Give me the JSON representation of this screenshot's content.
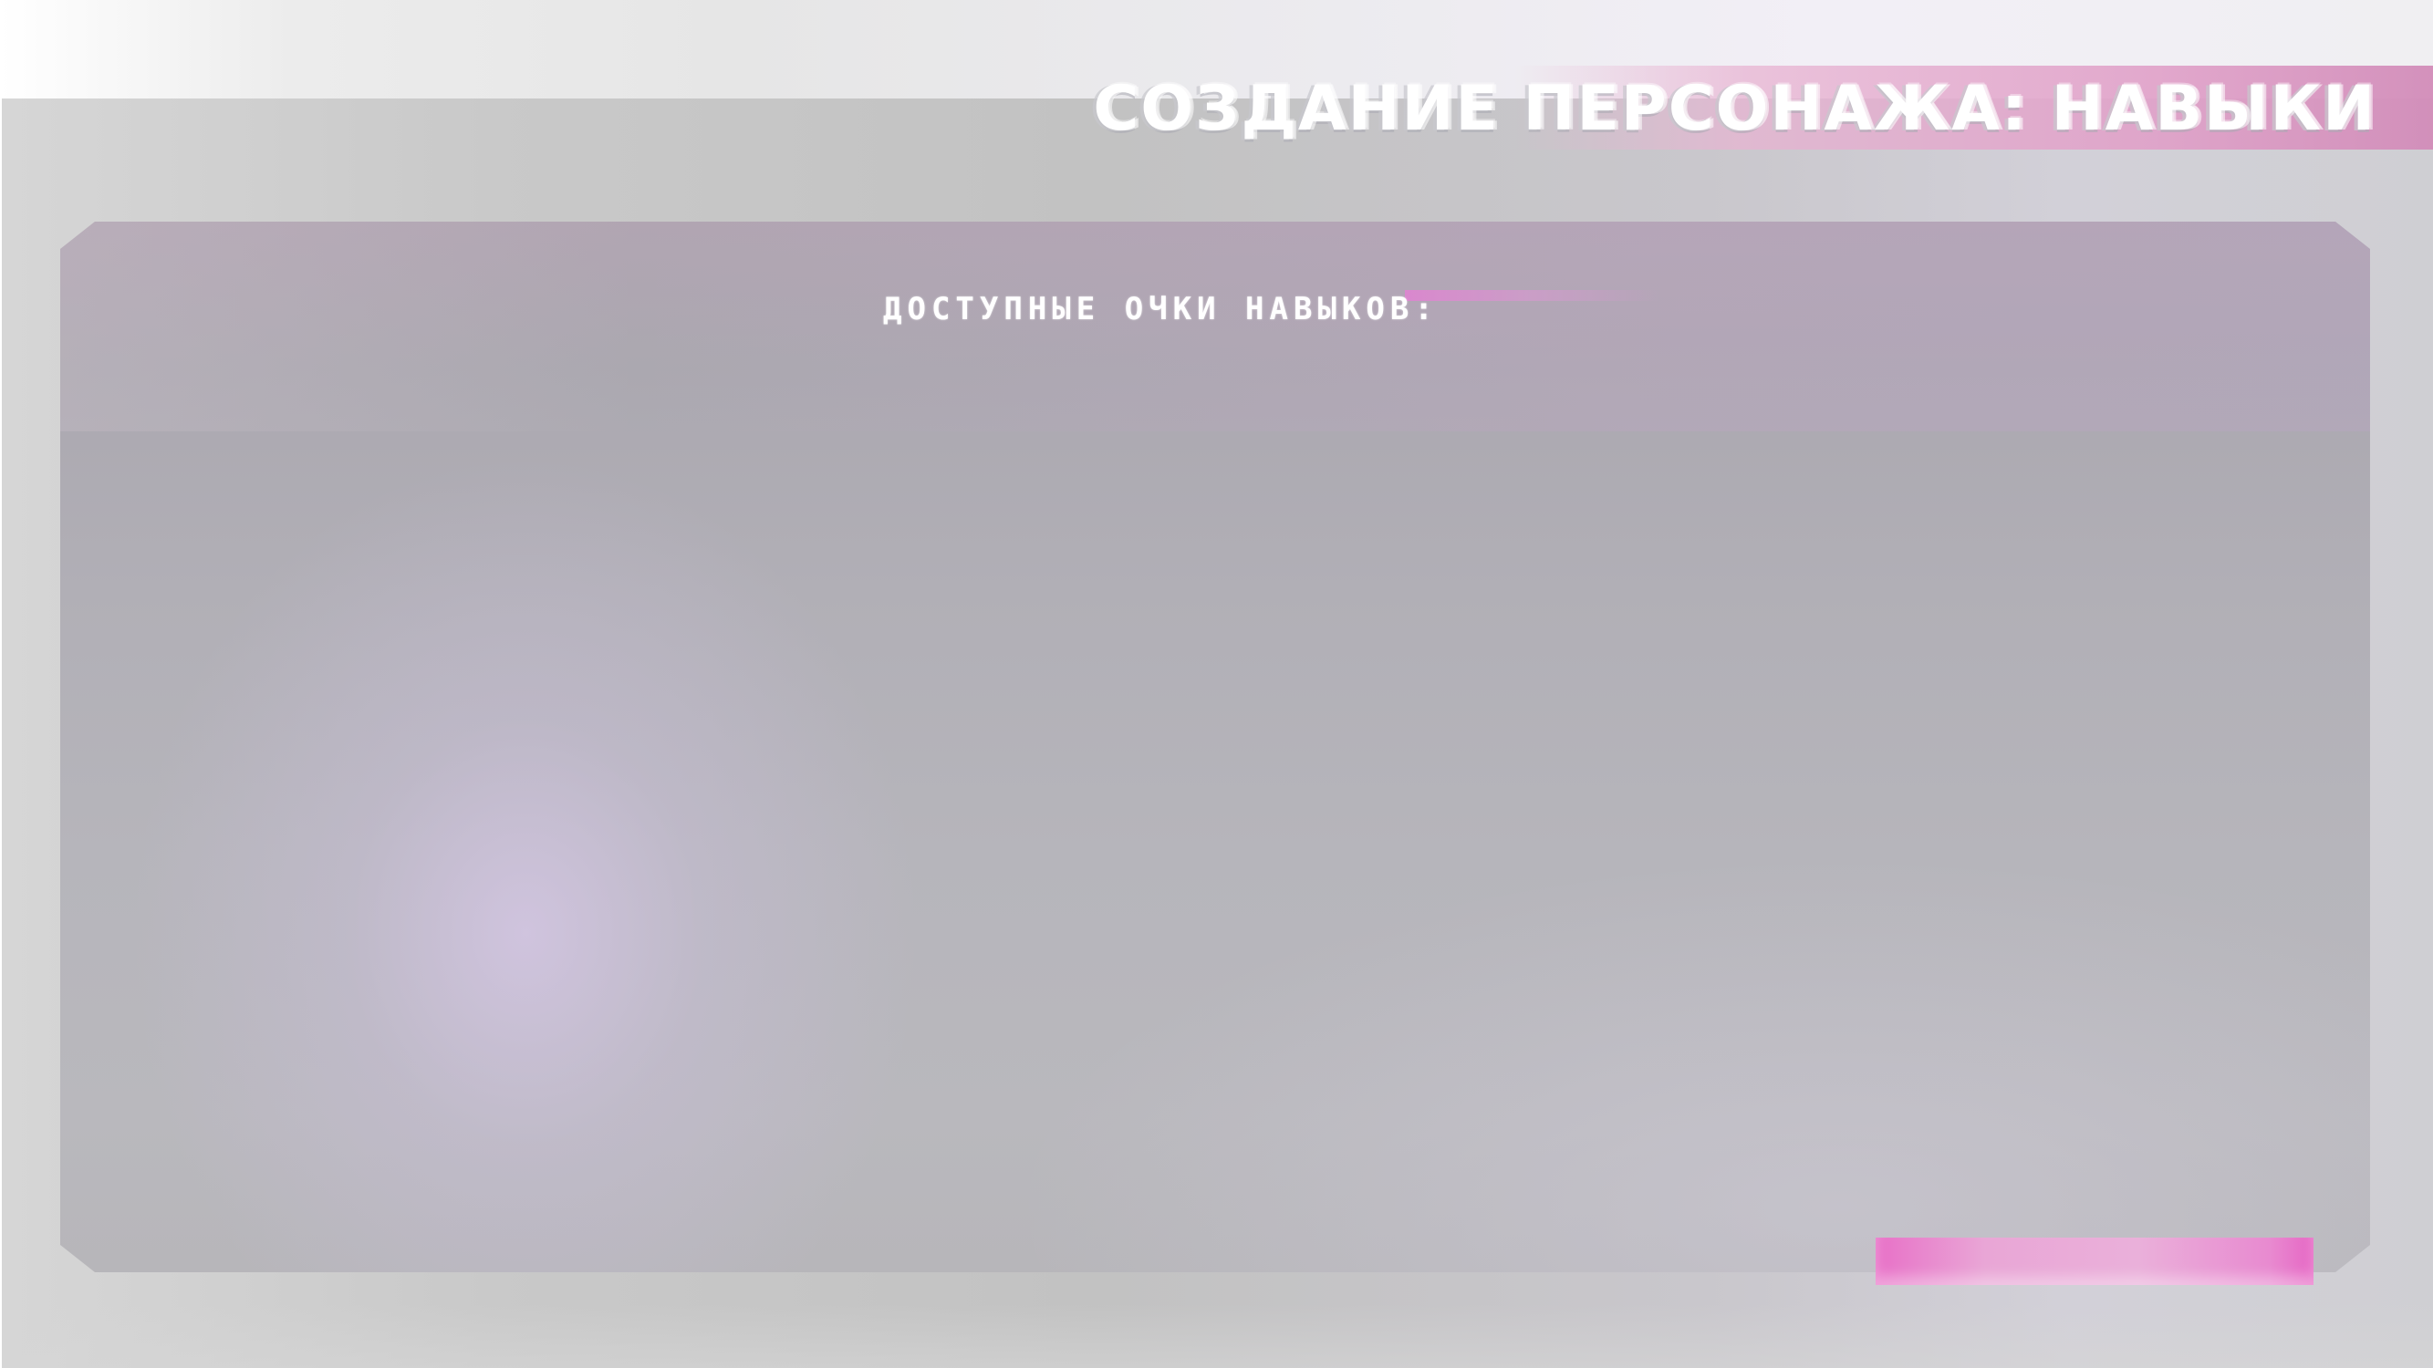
{
  "header": {
    "title": "СОЗДАНИЕ ПЕРСОНАЖА: НАВЫКИ"
  },
  "skills_panel": {
    "points_label": "ДОСТУПНЫЕ ОЧКИ НАВЫКОВ:",
    "points_value": "",
    "confirm_label": ""
  },
  "colors": {
    "accent": "#e870c7",
    "title_band": "#e0a0c8",
    "panel": "#b3b1b8",
    "frame": "#c6c6c6"
  }
}
